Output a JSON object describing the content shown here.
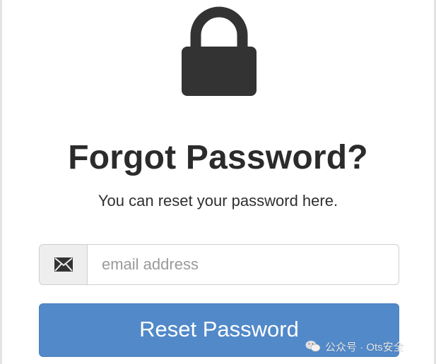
{
  "title": "Forgot Password?",
  "subtitle": "You can reset your password here.",
  "email": {
    "placeholder": "email address",
    "value": ""
  },
  "reset_button": {
    "label": "Reset Password"
  },
  "watermark": {
    "text": "公众号 · Ots安全"
  },
  "colors": {
    "button": "#5189c9",
    "lock": "#333333",
    "title": "#2b2b2b"
  },
  "icons": {
    "lock": "lock-icon",
    "email_addon": "envelope-icon",
    "watermark": "wechat-icon"
  }
}
